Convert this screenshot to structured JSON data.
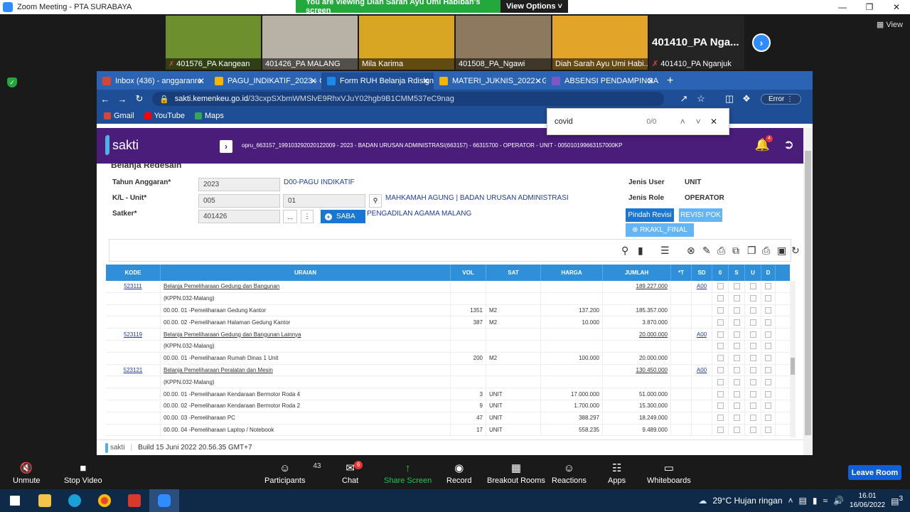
{
  "zoom": {
    "window_title": "Zoom Meeting - PTA SURABAYA",
    "banner_msg": "You are viewing Diah Sarah Ayu Umi Habibah's screen",
    "banner_options": "View Options",
    "view_label": "View",
    "participants_thumbs": [
      {
        "label": "401576_PA Kangean",
        "muted": true,
        "color": "#6e8f2d"
      },
      {
        "label": "401426_PA MALANG",
        "muted": false,
        "color": "#b8b2a6"
      },
      {
        "label": "Mila Karima",
        "muted": false,
        "color": "#d9a624"
      },
      {
        "label": "401508_PA_Ngawi",
        "muted": false,
        "color": "#8d7a5e"
      },
      {
        "label": "Diah Sarah Ayu Umi Habi...",
        "muted": false,
        "color": "#e2a52a"
      }
    ],
    "big_thumb_name": "401410_PA Nga...",
    "big_thumb_label": "401410_PA Nganjuk",
    "controls": [
      {
        "label": "Unmute",
        "icon": "mic-muted-icon"
      },
      {
        "label": "Stop Video",
        "icon": "camera-icon"
      },
      {
        "label": "Participants",
        "icon": "people-icon",
        "count": "43"
      },
      {
        "label": "Chat",
        "icon": "chat-icon",
        "badge": "6"
      },
      {
        "label": "Share Screen",
        "icon": "share-icon"
      },
      {
        "label": "Record",
        "icon": "record-icon"
      },
      {
        "label": "Breakout Rooms",
        "icon": "grid-icon"
      },
      {
        "label": "Reactions",
        "icon": "smile-icon"
      },
      {
        "label": "Apps",
        "icon": "apps-icon"
      },
      {
        "label": "Whiteboards",
        "icon": "whiteboard-icon"
      }
    ],
    "leave_label": "Leave Room"
  },
  "browser": {
    "tabs": [
      {
        "label": "Inbox (436) - anggaranre",
        "color": "#d44638"
      },
      {
        "label": "PAGU_INDIKATIF_2023 - G",
        "color": "#f4b400"
      },
      {
        "label": "Form RUH Belanja Rdisign",
        "color": "#1e88e5",
        "active": true
      },
      {
        "label": "MATERI_JUKNIS_2022 - G",
        "color": "#f4b400"
      },
      {
        "label": "ABSENSI PENDAMPINGAN",
        "color": "#7e57c2"
      }
    ],
    "url_host": "sakti.kemenkeu.go.id",
    "url_path": "/33cxpSXbmWMSlvE9RhxVJuY02hgb9B1CMM537eC9nag",
    "error_label": "Error",
    "bookmarks": [
      {
        "label": "Gmail",
        "color": "#d44638"
      },
      {
        "label": "YouTube",
        "color": "#ff0000"
      },
      {
        "label": "Maps",
        "color": "#34a853"
      }
    ],
    "find_term": "covid",
    "find_count": "0/0"
  },
  "sakti": {
    "logo_text": "sakti",
    "user_info": "opru_663157_199103292020122009 - 2023 - BADAN URUSAN ADMINISTRASI(663157) - 66315700 - OPERATOR - UNIT - 005010199663157000KP",
    "notif_count": "4",
    "page_title": "Belanja Redesain",
    "form": {
      "tahun_label": "Tahun Anggaran*",
      "tahun_value": "2023",
      "tahun_desc": "D00-PAGU INDIKATIF",
      "kl_label": "K/L - Unit*",
      "kl_value": "005",
      "unit_value": "01",
      "kl_desc": "MAHKAMAH AGUNG | BADAN URUSAN ADMINISTRASI",
      "satker_label": "Satker*",
      "satker_value": "401426",
      "satker_desc": "PENGADILAN AGAMA MALANG",
      "saba_label": "SABA",
      "more_label": "...",
      "kebab_label": "⋮",
      "jenis_user_label": "Jenis User",
      "jenis_user_value": "UNIT",
      "jenis_role_label": "Jenis Role",
      "jenis_role_value": "OPERATOR",
      "pindah_revisi_label": "Pindah Revisi",
      "revisi_pok_label": "REVISI POK",
      "rkakl_final_label": "RKAKL_FINAL"
    },
    "grid": {
      "headers": [
        "KODE",
        "URAIAN",
        "VOL",
        "SAT",
        "HARGA",
        "JUMLAH",
        "*T",
        "SD",
        "0",
        "S",
        "U",
        "D"
      ],
      "rows": [
        {
          "kode": "523111",
          "uraian": "Belanja Pemeliharaan Gedung dan Bangunan",
          "vol": "",
          "sat": "",
          "harga": "",
          "jumlah": "189.227.000",
          "sd": "A00",
          "head": true
        },
        {
          "kode": "",
          "uraian": "(KPPN.032-Malang)",
          "vol": "",
          "sat": "",
          "harga": "",
          "jumlah": "",
          "sd": ""
        },
        {
          "kode": "",
          "uraian": "00.00. 01 -Pemeliharaan Gedung Kantor",
          "vol": "1351",
          "sat": "M2",
          "harga": "137.200",
          "jumlah": "185.357.000",
          "sd": ""
        },
        {
          "kode": "",
          "uraian": "00.00. 02 -Pemeliharaan Halaman Gedung Kantor",
          "vol": "387",
          "sat": "M2",
          "harga": "10.000",
          "jumlah": "3.870.000",
          "sd": ""
        },
        {
          "kode": "523119",
          "uraian": "Belanja Pemeliharaan Gedung dan Bangunan Lainnya",
          "vol": "",
          "sat": "",
          "harga": "",
          "jumlah": "20.000.000",
          "sd": "A00",
          "head": true
        },
        {
          "kode": "",
          "uraian": "(KPPN.032-Malang)",
          "vol": "",
          "sat": "",
          "harga": "",
          "jumlah": "",
          "sd": ""
        },
        {
          "kode": "",
          "uraian": "00.00. 01 -Pemeliharaan Rumah Dinas 1 Unit",
          "vol": "200",
          "sat": "M2",
          "harga": "100.000",
          "jumlah": "20.000.000",
          "sd": ""
        },
        {
          "kode": "523121",
          "uraian": "Belanja Pemeliharaan Peralatan dan Mesin",
          "vol": "",
          "sat": "",
          "harga": "",
          "jumlah": "130.450.000",
          "sd": "A00",
          "head": true
        },
        {
          "kode": "",
          "uraian": "(KPPN.032-Malang)",
          "vol": "",
          "sat": "",
          "harga": "",
          "jumlah": "",
          "sd": ""
        },
        {
          "kode": "",
          "uraian": "00.00. 01 -Pemeliharaan Kendaraan Bermotor Roda 4",
          "vol": "3",
          "sat": "UNIT",
          "harga": "17.000.000",
          "jumlah": "51.000.000",
          "sd": ""
        },
        {
          "kode": "",
          "uraian": "00.00. 02 -Pemeliharaan Kendaraan Bermotor Roda 2",
          "vol": "9",
          "sat": "UNIT",
          "harga": "1.700.000",
          "jumlah": "15.300.000",
          "sd": ""
        },
        {
          "kode": "",
          "uraian": "00.00. 03 -Pemeliharaan PC",
          "vol": "47",
          "sat": "UNIT",
          "harga": "388.297",
          "jumlah": "18.249.000",
          "sd": ""
        },
        {
          "kode": "",
          "uraian": "00.00. 04 -Pemeliharaan Laptop / Notebook",
          "vol": "17",
          "sat": "UNIT",
          "harga": "558.235",
          "jumlah": "9.489.000",
          "sd": ""
        }
      ]
    },
    "footer_logo": "sakti",
    "build_info": "Build 15 Juni 2022 20.56.35 GMT+7"
  },
  "taskbar": {
    "weather": "29°C Hujan ringan",
    "time": "16.01",
    "date": "16/06/2022",
    "notif": "3"
  }
}
